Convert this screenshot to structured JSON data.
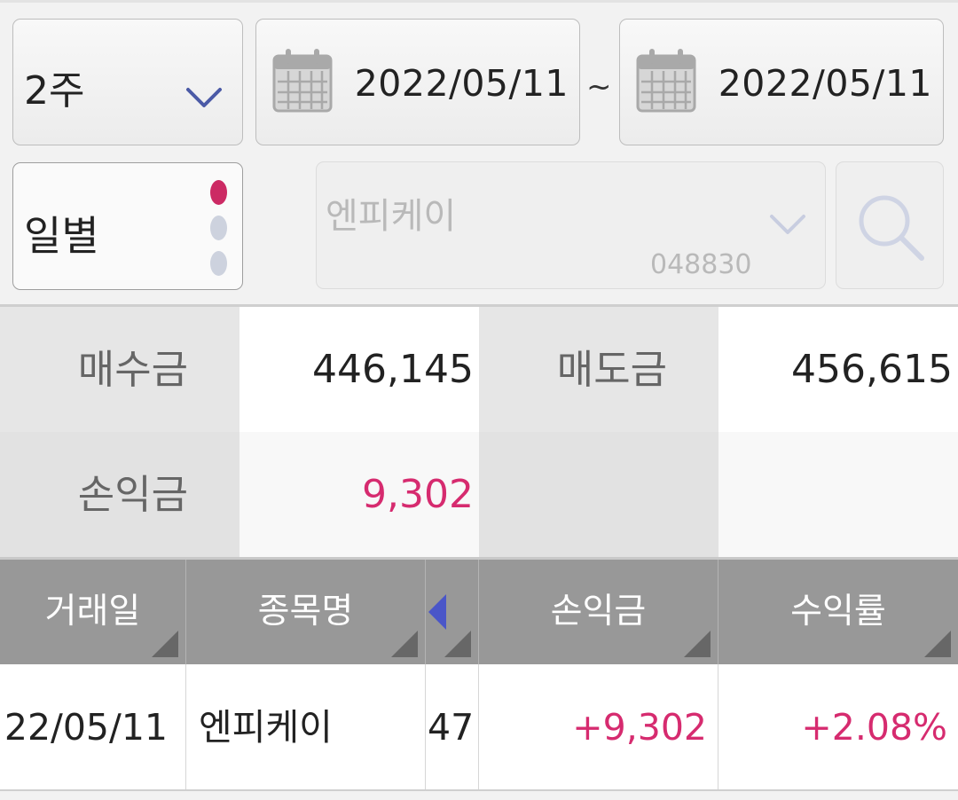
{
  "filters": {
    "period_value": "2주",
    "date_from": "2022/05/11",
    "date_separator": "~",
    "date_to": "2022/05/11",
    "view_mode": "일별",
    "view_mode_page": 1,
    "view_mode_pages": 3,
    "stock_name": "엔피케이",
    "stock_code": "048830"
  },
  "summary": {
    "buy_label": "매수금",
    "buy_value": "446,145",
    "sell_label": "매도금",
    "sell_value": "456,615",
    "profit_label": "손익금",
    "profit_value": "9,302"
  },
  "table": {
    "headers": [
      "거래일",
      "종목명",
      "",
      "손익금",
      "수익률"
    ],
    "rows": [
      {
        "date": "22/05/11",
        "name": "엔피케이",
        "qty": "47",
        "profit": "+9,302",
        "rate": "+2.08%"
      }
    ]
  },
  "colors": {
    "accent_pink": "#d62b6f",
    "arrow_blue": "#4a56c8",
    "header_gray": "#989898"
  },
  "icons": [
    "chevron-down-icon",
    "calendar-icon",
    "search-icon",
    "left-arrow-icon",
    "sort-corner-icon"
  ]
}
